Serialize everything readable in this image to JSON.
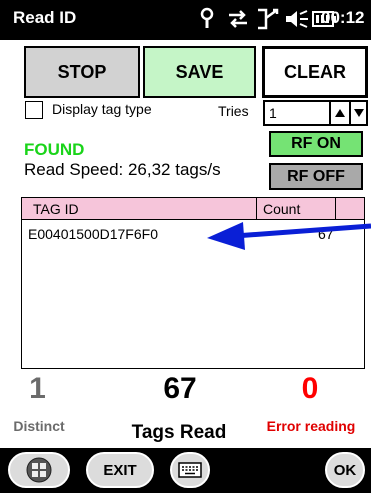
{
  "titlebar": {
    "title": "Read ID",
    "time": "00:12",
    "status_icons": [
      "antenna-icon",
      "sync-arrows-icon",
      "connection-icon",
      "volume-icon",
      "battery-icon"
    ]
  },
  "buttons": {
    "stop": "STOP",
    "save": "SAVE",
    "clear": "CLEAR",
    "rf_on": "RF ON",
    "rf_off": "RF OFF"
  },
  "options": {
    "display_tag_type_label": "Display tag type",
    "display_tag_type_checked": false,
    "tries_label": "Tries",
    "tries_value": "1"
  },
  "status": {
    "found": "FOUND",
    "read_speed": "Read Speed: 26,32 tags/s"
  },
  "table": {
    "headers": [
      "TAG ID",
      "Count"
    ],
    "rows": [
      {
        "tag_id": "E00401500D17F6F0",
        "count": "67"
      }
    ]
  },
  "stats": {
    "distinct_value": "1",
    "distinct_label": "Distinct",
    "tags_read_value": "67",
    "tags_read_label": "Tags Read",
    "error_value": "0",
    "error_label": "Error reading"
  },
  "bottombar": {
    "exit": "EXIT",
    "ok": "OK"
  },
  "colors": {
    "found": "#1ad41a",
    "save_bg": "#c5f5c7",
    "rf_on_bg": "#75e374",
    "header_bg": "#f6c5da",
    "error": "#ff0000",
    "arrow": "#0a1fd6"
  }
}
